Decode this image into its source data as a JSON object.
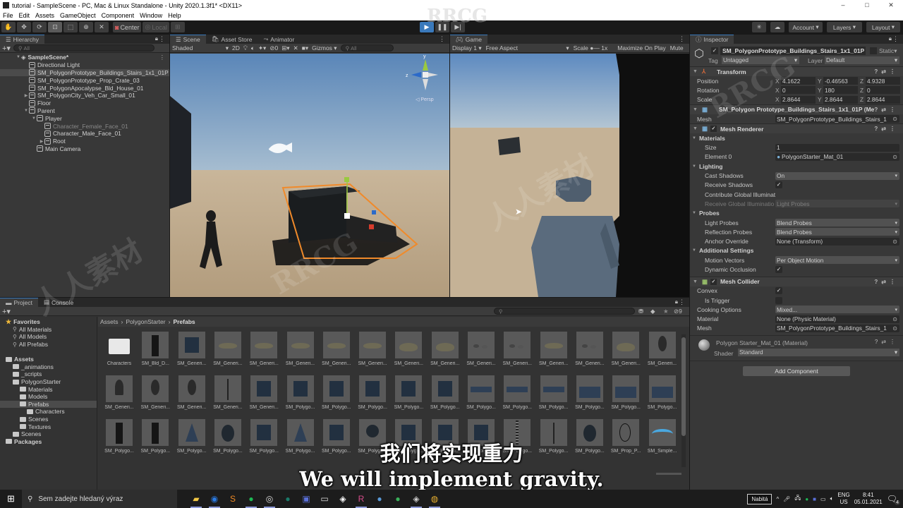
{
  "window": {
    "title": "tutorial - SampleScene - PC, Mac & Linux Standalone - Unity 2020.1.3f1* <DX11>",
    "controls": [
      "–",
      "□",
      "✕"
    ]
  },
  "menu": [
    "File",
    "Edit",
    "Assets",
    "GameObject",
    "Component",
    "Window",
    "Help"
  ],
  "toolbar": {
    "tools": [
      "hand-tool",
      "move-tool",
      "rotate-tool",
      "scale-tool",
      "rect-tool",
      "transform-tool",
      "custom-tool"
    ],
    "pivot": "Center",
    "space": "Local",
    "account": "Account",
    "layers": "Layers",
    "layout": "Layout"
  },
  "hierarchy": {
    "tab": "Hierarchy",
    "search_placeholder": "All",
    "scene": "SampleScene*",
    "items": [
      {
        "label": "Directional Light",
        "depth": 1,
        "expand": ""
      },
      {
        "label": "SM_PolygonPrototype_Buildings_Stairs_1x1_01P",
        "depth": 1,
        "expand": "",
        "selected": true
      },
      {
        "label": "SM_PolygonPrototype_Prop_Crate_03",
        "depth": 1,
        "expand": ""
      },
      {
        "label": "SM_PolygonApocalypse_Bld_House_01",
        "depth": 1,
        "expand": ""
      },
      {
        "label": "SM_PolygonCity_Veh_Car_Small_01",
        "depth": 1,
        "expand": "▶"
      },
      {
        "label": "Floor",
        "depth": 1,
        "expand": ""
      },
      {
        "label": "Parent",
        "depth": 1,
        "expand": "▼"
      },
      {
        "label": "Player",
        "depth": 2,
        "expand": "▼"
      },
      {
        "label": "Character_Female_Face_01",
        "depth": 3,
        "expand": "",
        "dimmed": true
      },
      {
        "label": "Character_Male_Face_01",
        "depth": 3,
        "expand": ""
      },
      {
        "label": "Root",
        "depth": 3,
        "expand": "▶"
      },
      {
        "label": "Main Camera",
        "depth": 2,
        "expand": ""
      }
    ]
  },
  "scene_view": {
    "tabs": [
      "Scene",
      "Asset Store",
      "Animator"
    ],
    "shading": "Shaded",
    "mode_2d": "2D",
    "hidden_count": "0",
    "gizmos": "Gizmos",
    "search_placeholder": "All",
    "gizmo_axes": {
      "y": "y",
      "z": "z"
    },
    "persp_label": "◁ Persp"
  },
  "game_view": {
    "tab": "Game",
    "display": "Display 1",
    "aspect": "Free Aspect",
    "scale_label": "Scale",
    "scale_value": "1x",
    "maximize": "Maximize On Play",
    "mute": "Mute"
  },
  "inspector": {
    "tab": "Inspector",
    "object_name": "SM_PolygonPrototype_Buildings_Stairs_1x1_01P",
    "static_label": "Static",
    "tag_label": "Tag",
    "tag": "Untagged",
    "layer_label": "Layer",
    "layer": "Default",
    "transform": {
      "title": "Transform",
      "rows": [
        {
          "label": "Position",
          "x": "4.1622",
          "y": "-0.46563",
          "z": "4.9328"
        },
        {
          "label": "Rotation",
          "x": "0",
          "y": "180",
          "z": "0"
        },
        {
          "label": "Scale",
          "x": "2.8644",
          "y": "2.8644",
          "z": "2.8644"
        }
      ]
    },
    "mesh_filter": {
      "title": "SM_Polygon Prototype_Buildings_Stairs_1x1_01P (Mesh",
      "mesh_label": "Mesh",
      "mesh": "SM_PolygonPrototype_Buildings_Stairs_1"
    },
    "mesh_renderer": {
      "title": "Mesh Renderer",
      "materials": "Materials",
      "size_label": "Size",
      "size": "1",
      "element_label": "Element 0",
      "element": "PolygonStarter_Mat_01",
      "lighting": "Lighting",
      "cast_shadows_label": "Cast Shadows",
      "cast_shadows": "On",
      "receive_shadows_label": "Receive Shadows",
      "contribute_gi_label": "Contribute Global Illuminat",
      "receive_gi_label": "Receive Global Illuminatio",
      "receive_gi": "Light Probes",
      "probes": "Probes",
      "light_probes_label": "Light Probes",
      "light_probes": "Blend Probes",
      "reflection_probes_label": "Reflection Probes",
      "reflection_probes": "Blend Probes",
      "anchor_label": "Anchor Override",
      "anchor": "None (Transform)",
      "additional": "Additional Settings",
      "motion_label": "Motion Vectors",
      "motion": "Per Object Motion",
      "dynamic_occlusion_label": "Dynamic Occlusion"
    },
    "mesh_collider": {
      "title": "Mesh Collider",
      "convex_label": "Convex",
      "trigger_label": "Is Trigger",
      "cooking_label": "Cooking Options",
      "cooking": "Mixed...",
      "material_label": "Material",
      "material": "None (Physic Material)",
      "mesh_label": "Mesh",
      "mesh": "SM_PolygonPrototype_Buildings_Stairs_1"
    },
    "material": {
      "title": "Polygon Starter_Mat_01 (Material)",
      "shader_label": "Shader",
      "shader": "Standard"
    },
    "add_component": "Add Component"
  },
  "project": {
    "tabs": [
      "Project",
      "Console"
    ],
    "hidden_count": "9",
    "breadcrumb": [
      "Assets",
      "PolygonStarter",
      "Prefabs"
    ],
    "tree": [
      {
        "label": "Favorites",
        "kind": "fav",
        "depth": 0,
        "bold": true
      },
      {
        "label": "All Materials",
        "kind": "search",
        "depth": 1
      },
      {
        "label": "All Models",
        "kind": "search",
        "depth": 1
      },
      {
        "label": "All Prefabs",
        "kind": "search",
        "depth": 1
      },
      {
        "label": "",
        "kind": "gap",
        "depth": 0
      },
      {
        "label": "Assets",
        "kind": "folder",
        "depth": 0,
        "bold": true
      },
      {
        "label": "_animations",
        "kind": "folder",
        "depth": 1
      },
      {
        "label": "_scripts",
        "kind": "folder",
        "depth": 1
      },
      {
        "label": "PolygonStarter",
        "kind": "folder",
        "depth": 1
      },
      {
        "label": "Materials",
        "kind": "folder",
        "depth": 2
      },
      {
        "label": "Models",
        "kind": "folder",
        "depth": 2
      },
      {
        "label": "Prefabs",
        "kind": "folder",
        "depth": 2,
        "selected": true
      },
      {
        "label": "Characters",
        "kind": "folder",
        "depth": 3
      },
      {
        "label": "Scenes",
        "kind": "folder",
        "depth": 2
      },
      {
        "label": "Textures",
        "kind": "folder",
        "depth": 2
      },
      {
        "label": "Scenes",
        "kind": "folder",
        "depth": 1
      },
      {
        "label": "Packages",
        "kind": "folder",
        "depth": 0,
        "bold": true
      }
    ],
    "assets": [
      "Characters",
      "SM_Bld_D...",
      "SM_Generi...",
      "SM_Generi...",
      "SM_Generi...",
      "SM_Generi...",
      "SM_Generi...",
      "SM_Generi...",
      "SM_Generi...",
      "SM_Generi...",
      "SM_Generi...",
      "SM_Generi...",
      "SM_Generi...",
      "SM_Generi...",
      "SM_Generi...",
      "SM_Generi...",
      "SM_Generi...",
      "SM_Generi...",
      "SM_Generi...",
      "SM_Generi...",
      "SM_Generi...",
      "SM_Polygo...",
      "SM_Polygo...",
      "SM_Polygo...",
      "SM_Polygo...",
      "SM_Polygo...",
      "SM_Polygo...",
      "SM_Polygo...",
      "SM_Polygo...",
      "SM_Polygo...",
      "SM_Polygo...",
      "SM_Polygo...",
      "SM_Polygo...",
      "SM_Polygo...",
      "SM_Polygo...",
      "SM_Polygo...",
      "SM_Polygo...",
      "SM_Polygo...",
      "SM_Polygo...",
      "SM_Polygo...",
      "SM_Polygo...",
      "SM_Polygo...",
      "SM_Polygo...",
      "SM_Polygo...",
      "SM_Polygo...",
      "SM_Polygo...",
      "SM_Prop_P...",
      "SM_Simple..."
    ]
  },
  "subtitles": {
    "chinese": "我们将实现重力",
    "english": "We will implement gravity."
  },
  "taskbar": {
    "search_placeholder": "Sem zadejte hledaný výraz",
    "apps": [
      "file-explorer",
      "firefox",
      "sublime",
      "spotify",
      "obs",
      "app-teal",
      "save-app",
      "monitor-app",
      "unity",
      "rider",
      "app-blue",
      "app-green",
      "unity-hub",
      "chrome"
    ],
    "battery": "Nabitá",
    "lang": "ENG",
    "region": "US",
    "time": "8:41",
    "date": "05.01.2021",
    "notifications": "4"
  },
  "watermarks": [
    "RRCG",
    "人人素材"
  ]
}
